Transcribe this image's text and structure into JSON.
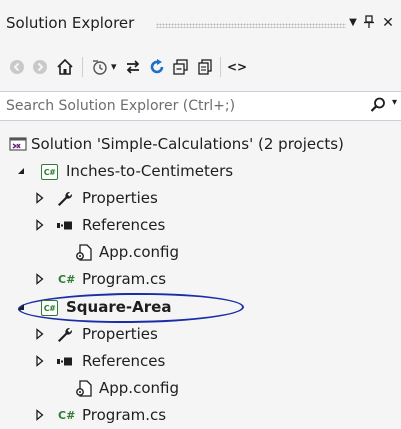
{
  "titlebar": {
    "title": "Solution Explorer",
    "dropdown_glyph": "▼",
    "pin_glyph": "ㅁ",
    "close_glyph": "✕"
  },
  "toolbar": {
    "icons": [
      "back-icon",
      "forward-icon",
      "home-icon",
      "pending-changes-icon",
      "sync-icon",
      "refresh-icon",
      "collapse-all-icon",
      "show-all-files-icon",
      "code-icon"
    ],
    "code_glyph": "<>",
    "dropdown_glyph": "▾"
  },
  "search": {
    "placeholder": "Search Solution Explorer (Ctrl+;)",
    "dropdown_glyph": "▾"
  },
  "tree": {
    "solution": {
      "label": "Solution 'Simple-Calculations' (2 projects)"
    },
    "projects": [
      {
        "label": "Inches-to-Centimeters",
        "project_badge": "C#",
        "children": [
          {
            "label": "Properties",
            "kind": "properties"
          },
          {
            "label": "References",
            "kind": "references"
          },
          {
            "label": "App.config",
            "kind": "config"
          },
          {
            "label": "Program.cs",
            "kind": "csharp",
            "badge": "C#"
          }
        ]
      },
      {
        "label": "Square-Area",
        "project_badge": "C#",
        "children": [
          {
            "label": "Properties",
            "kind": "properties"
          },
          {
            "label": "References",
            "kind": "references"
          },
          {
            "label": "App.config",
            "kind": "config"
          },
          {
            "label": "Program.cs",
            "kind": "csharp",
            "badge": "C#"
          }
        ]
      }
    ]
  },
  "colors": {
    "background": "#f5f5f5",
    "csharp_green": "#2e7d32",
    "solution_purple": "#68217a",
    "refresh_blue": "#1e6fc6",
    "highlight_ellipse": "#1a2ea8"
  }
}
